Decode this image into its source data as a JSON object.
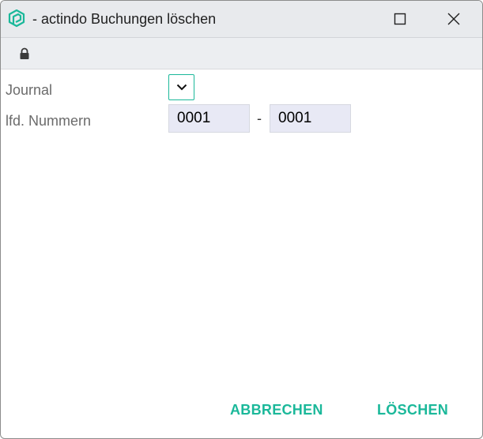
{
  "window": {
    "title": "- actindo Buchungen löschen",
    "accent_color": "#1bb89a",
    "icons": {
      "app": "actindo-logo-icon",
      "maximize": "maximize-icon",
      "close": "close-icon",
      "secure": "lock-icon"
    }
  },
  "form": {
    "journal": {
      "label": "Journal",
      "selected": "",
      "dropdown_icon": "chevron-down-icon"
    },
    "range": {
      "label": "lfd. Nummern",
      "from": "0001",
      "separator": "-",
      "to": "0001"
    }
  },
  "actions": {
    "cancel_label": "ABBRECHEN",
    "delete_label": "LÖSCHEN"
  }
}
